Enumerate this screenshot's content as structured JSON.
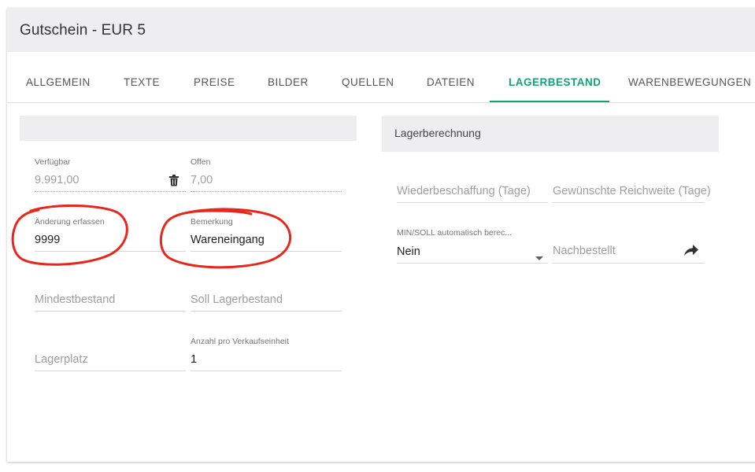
{
  "header": {
    "title": "Gutschein - EUR 5"
  },
  "tabs": [
    {
      "label": "ALLGEMEIN"
    },
    {
      "label": "TEXTE"
    },
    {
      "label": "PREISE"
    },
    {
      "label": "BILDER"
    },
    {
      "label": "QUELLEN"
    },
    {
      "label": "DATEIEN"
    },
    {
      "label": "LAGERBESTAND",
      "active": true
    },
    {
      "label": "WARENBEWEGUNGEN"
    }
  ],
  "left": {
    "verfuegbar": {
      "label": "Verfügbar",
      "value": "9.991,00"
    },
    "offen": {
      "label": "Offen",
      "value": "7,00"
    },
    "aenderung": {
      "label": "Änderung erfassen",
      "value": "9999"
    },
    "bemerkung": {
      "label": "Bemerkung",
      "value": "Wareneingang"
    },
    "mindestbestand": {
      "placeholder": "Mindestbestand"
    },
    "soll": {
      "placeholder": "Soll Lagerbestand"
    },
    "lagerplatz": {
      "placeholder": "Lagerplatz"
    },
    "anzahl": {
      "label": "Anzahl pro Verkaufseinheit",
      "value": "1"
    }
  },
  "right": {
    "section_title": "Lagerberechnung",
    "wiederbeschaffung": {
      "placeholder": "Wiederbeschaffung (Tage)"
    },
    "reichweite": {
      "placeholder": "Gewünschte Reichweite (Tage)"
    },
    "minsoll": {
      "label": "MIN/SOLL automatisch berec...",
      "value": "Nein"
    },
    "nachbestellt": {
      "placeholder": "Nachbestellt"
    }
  },
  "colors": {
    "accent": "#12a276",
    "annotation": "#e8261c",
    "header_bg": "#eeedef"
  }
}
